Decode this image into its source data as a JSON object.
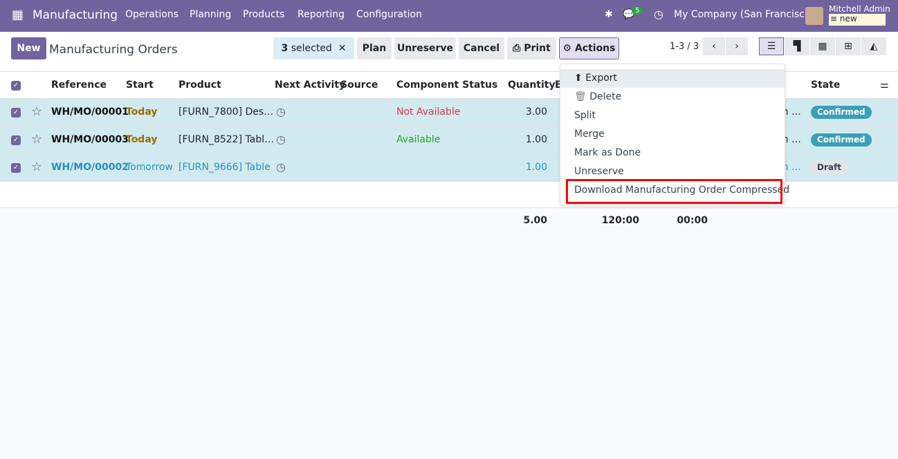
{
  "navbar": {
    "app": "Manufacturing",
    "menus": [
      "Operations",
      "Planning",
      "Products",
      "Reporting",
      "Configuration"
    ],
    "chat_count": "5",
    "company": "My Company (San Francisco)",
    "user": "Mitchell Admin",
    "db": "new",
    "color": "#71639e"
  },
  "control": {
    "new": "New",
    "title": "Manufacturing Orders",
    "selected_count": "3",
    "selected_label": "selected",
    "buttons": {
      "plan": "Plan",
      "unreserve": "Unreserve",
      "cancel": "Cancel",
      "print": "Print",
      "actions": "Actions"
    },
    "pager": "1-3 / 3"
  },
  "columns": [
    "Reference",
    "Start",
    "Product",
    "Next Activity",
    "Source",
    "Component Status",
    "Quantity",
    "E",
    "State"
  ],
  "rows": [
    {
      "ref": "WH/MO/00001",
      "start": "Today",
      "product": "[FURN_7800] Des…",
      "component": "Not Available",
      "qty": "3.00",
      "hidden": "an …",
      "state": "Confirmed"
    },
    {
      "ref": "WH/MO/00003",
      "start": "Today",
      "product": "[FURN_8522] Tabl…",
      "component": "Available",
      "qty": "1.00",
      "hidden": "an …",
      "state": "Confirmed"
    },
    {
      "ref": "WH/MO/00002",
      "start": "Tomorrow",
      "product": "[FURN_9666] Table",
      "component": "",
      "qty": "1.00",
      "hidden": "an …",
      "state": "Draft"
    }
  ],
  "totals": {
    "qty": "5.00",
    "t1": "120:00",
    "t2": "00:00"
  },
  "actions_menu": [
    "Export",
    "Delete",
    "Split",
    "Merge",
    "Mark as Done",
    "Unreserve",
    "Download Manufacturing Order Compressed"
  ]
}
